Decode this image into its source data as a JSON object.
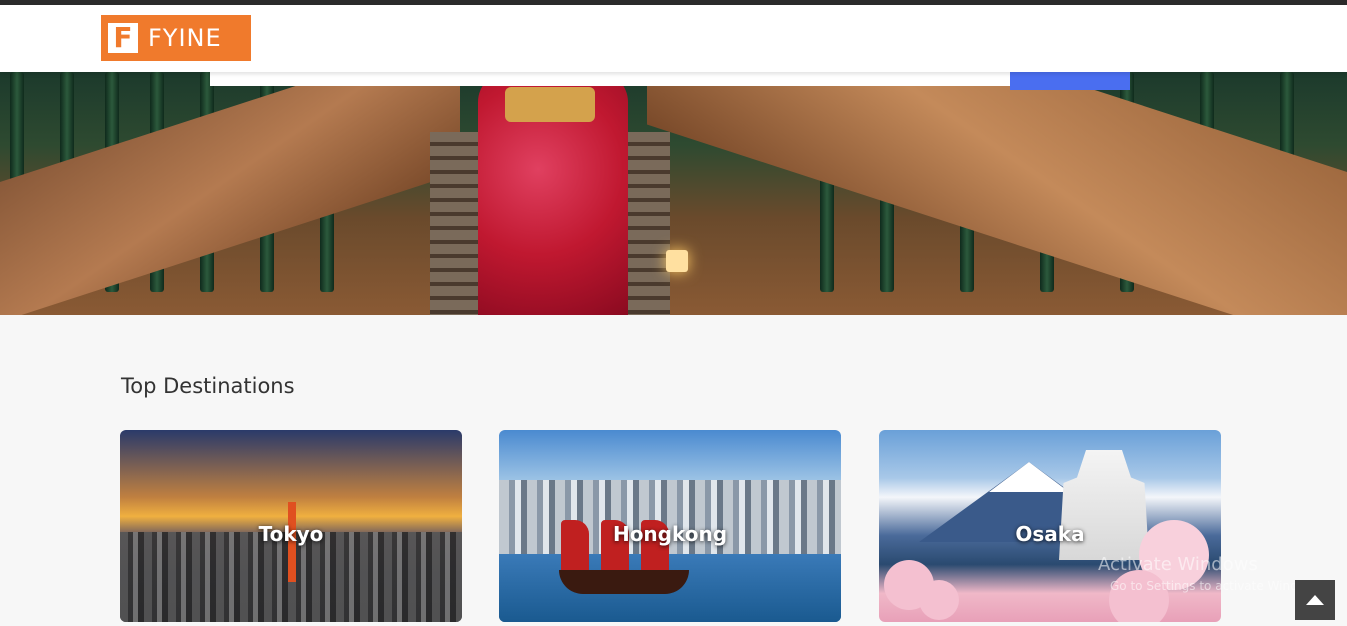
{
  "header": {
    "logo_letter": "F",
    "logo_text": "FYINE"
  },
  "hero": {
    "image_alt": "Kimono woman on bamboo path stairs",
    "search_button_icon": "search-icon"
  },
  "section": {
    "title": "Top Destinations"
  },
  "destinations": [
    {
      "label": "Tokyo"
    },
    {
      "label": "Hongkong"
    },
    {
      "label": "Osaka"
    }
  ],
  "overlay": {
    "watermark_line1": "Activate Windows",
    "watermark_line2": "Go to Settings to activate Windows."
  },
  "scroll_top": {
    "icon": "chevron-up-icon"
  },
  "colors": {
    "brand": "#f07a2c",
    "search_button": "#4a6ef0",
    "topline": "#2b2b2b"
  }
}
